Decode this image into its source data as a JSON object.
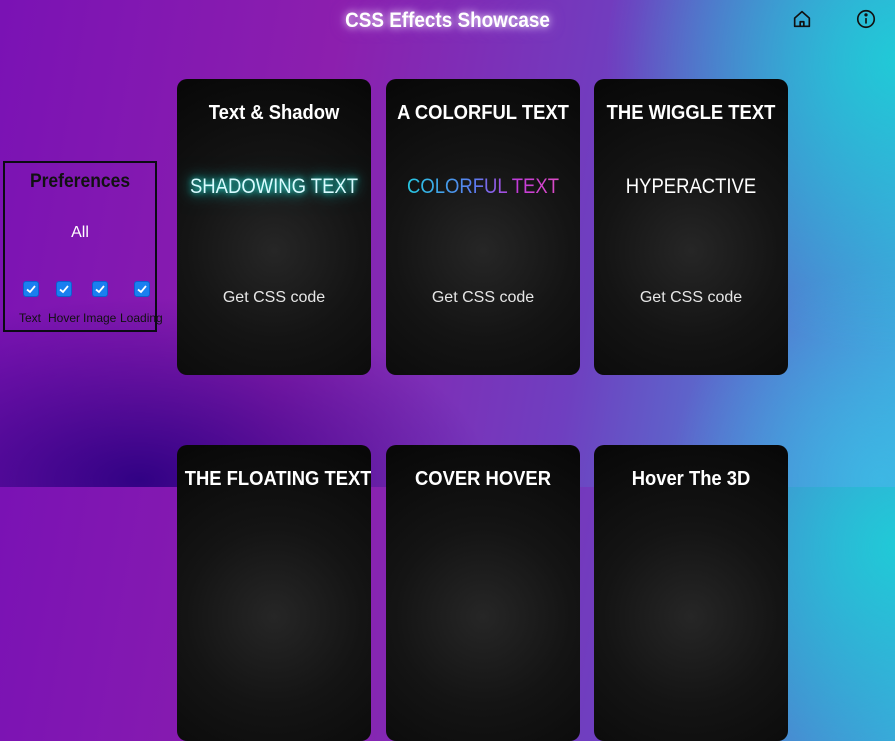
{
  "header": {
    "title": "CSS Effects Showcase",
    "home_icon": "home-icon",
    "info_icon": "info-icon"
  },
  "preferences": {
    "title": "Preferences",
    "all_label": "All",
    "options": [
      {
        "label": "Text",
        "checked": true
      },
      {
        "label": "Hover",
        "checked": true
      },
      {
        "label": "Image",
        "checked": true
      },
      {
        "label": "Loading",
        "checked": true
      }
    ]
  },
  "cards": [
    {
      "title": "Text & Shadow",
      "demo": "SHADOWING TEXT",
      "code_link": "Get CSS code"
    },
    {
      "title": "A COLORFUL TEXT",
      "demo": "COLORFUL TEXT",
      "code_link": "Get CSS code"
    },
    {
      "title": "THE WIGGLE TEXT",
      "demo": "HYPERACTIVE",
      "code_link": "Get CSS code"
    },
    {
      "title": "THE FLOATING TEXT"
    },
    {
      "title": "COVER HOVER"
    },
    {
      "title": "Hover The 3D"
    }
  ],
  "colors": {
    "accent_cyan": "#1fc9c0",
    "checkbox_blue": "#1a7ff0",
    "card_bg": "#0d0d0d"
  }
}
